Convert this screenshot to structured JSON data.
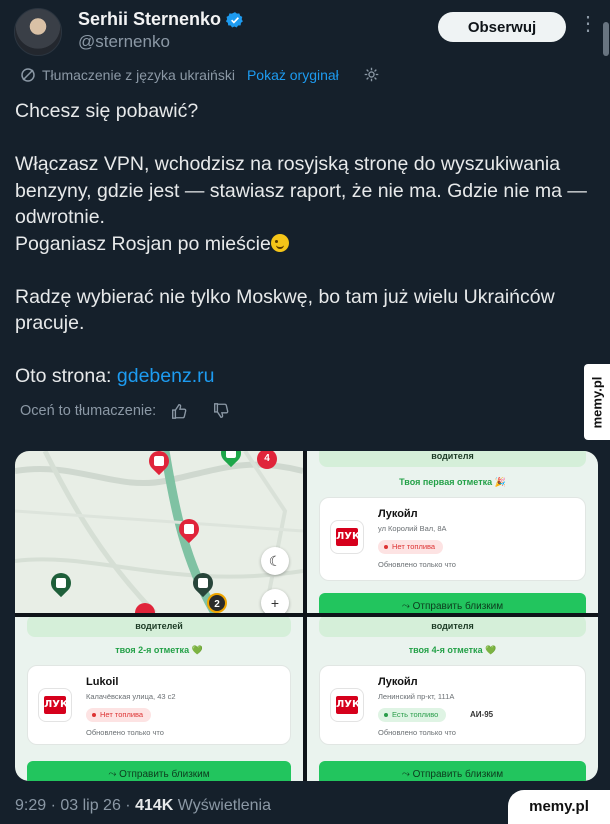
{
  "author": {
    "name": "Serhii Sternenko",
    "handle": "@sternenko",
    "follow_label": "Obserwuj",
    "more_icon": "more-icon",
    "verified_icon": "verified-badge-icon",
    "accent_color": "#1d9bf0"
  },
  "translation": {
    "label": "Tłumaczenie z języka ukraiński",
    "show_original": "Pokaż oryginał"
  },
  "tweet": {
    "line1": "Chcesz się pobawić?",
    "para2": "Włączasz VPN, wchodzisz na rosyjską stronę do wyszukiwania benzyny, gdzie jest — stawiasz raport, że nie ma. Gdzie nie ma — odwrotnie.",
    "para3": "Poganiasz Rosjan po mieście",
    "para4": "Radzę wybierać nie tylko Moskwę, bo tam już wielu Ukraińców pracuje.",
    "para5_prefix": "Oto strona: ",
    "link": "gdebenz.ru"
  },
  "rate_translation": "Oceń to tłumaczenie:",
  "side_watermark": "memy.pl",
  "image_grid": {
    "map": {
      "cluster_a": "4",
      "cluster_b": "2",
      "zoom_in": "+"
    },
    "panel_tr": {
      "banner": "водителя",
      "mark": "Твоя первая отметка 🎉",
      "name": "Лукойл",
      "address": "ул Королий Вал, 8А",
      "status": "Нет топлива",
      "updated": "Обновлено только что",
      "button": "Отправить близким"
    },
    "panel_bl": {
      "banner": "водителей",
      "mark": "твоя 2-я отметка 💚",
      "name": "Lukoil",
      "address": "Калачёвская улица, 43 с2",
      "status": "Нет топлива",
      "updated": "Обновлено только что",
      "button": "Отправить близким"
    },
    "panel_br": {
      "banner": "водителя",
      "mark": "твоя 4-я отметка 💚",
      "name": "Лукойл",
      "address": "Ленинский пр-кт, 111А",
      "status": "Есть топливо",
      "fuel": "АИ-95",
      "updated": "Обновлено только что",
      "button": "Отправить близким"
    },
    "logo_text": "ЛУК"
  },
  "footer": {
    "time_date": "9:29 · 03 lip 26 · ",
    "views_count": "414K",
    "views_label": " Wyświetlenia"
  },
  "corner_watermark": "memy.pl"
}
